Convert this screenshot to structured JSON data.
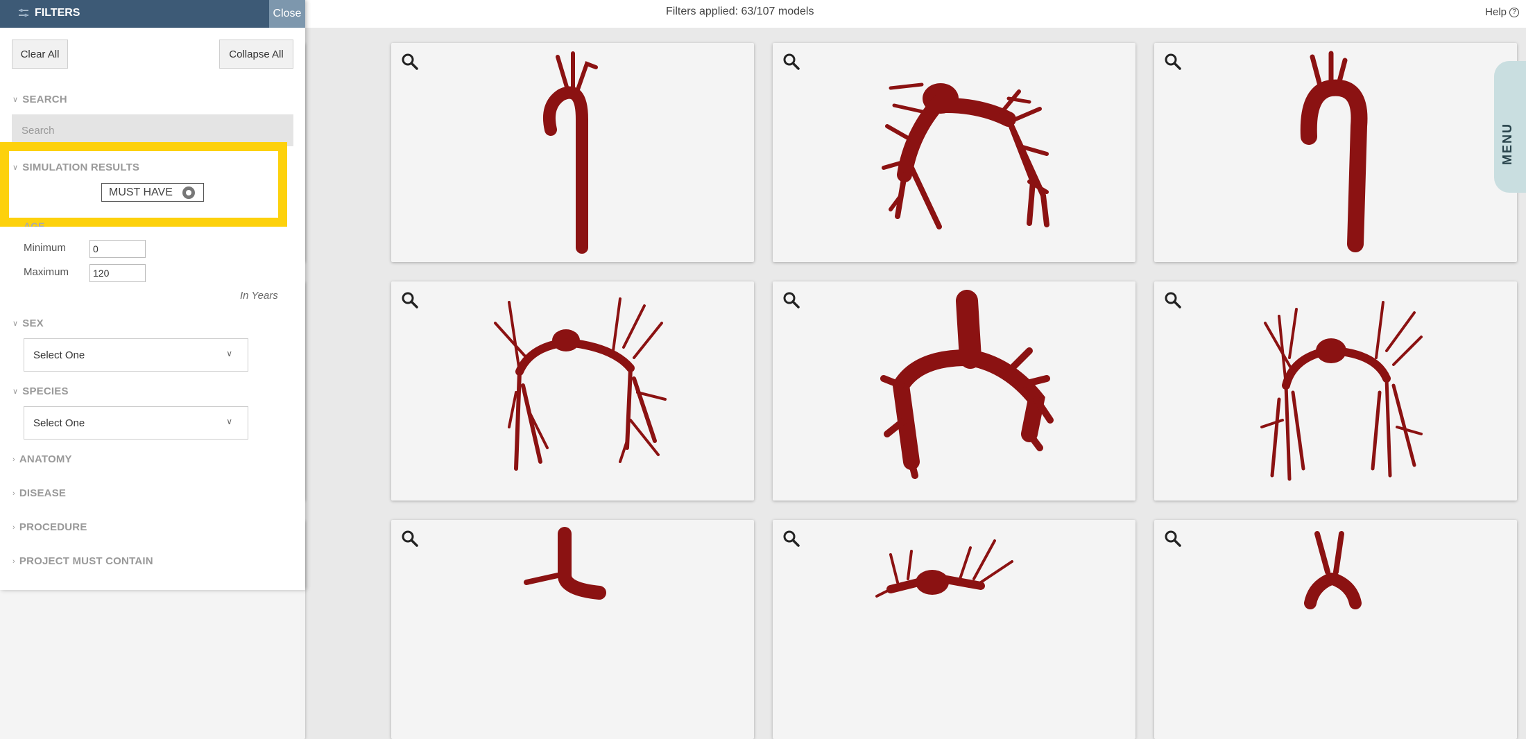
{
  "topbar": {
    "filters_applied": "Filters applied: 63/107 models",
    "help_label": "Help",
    "help_icon": "?"
  },
  "menu_tab": {
    "label": "MENU"
  },
  "panel": {
    "title": "FILTERS",
    "close_label": "Close",
    "clear_all_label": "Clear All",
    "collapse_all_label": "Collapse All",
    "search": {
      "heading": "SEARCH",
      "placeholder": "Search"
    },
    "simulation_results": {
      "heading": "SIMULATION RESULTS",
      "toggle_label": "MUST HAVE"
    },
    "age": {
      "heading": "AGE",
      "minimum_label": "Minimum",
      "minimum_value": "0",
      "maximum_label": "Maximum",
      "maximum_value": "120",
      "unit_note": "In Years"
    },
    "sex": {
      "heading": "SEX",
      "selected": "Select One"
    },
    "species": {
      "heading": "SPECIES",
      "selected": "Select One"
    },
    "collapsed_sections": [
      "ANATOMY",
      "DISEASE",
      "PROCEDURE",
      "PROJECT MUST CONTAIN"
    ]
  },
  "colors": {
    "panel_header": "#3d5a76",
    "close_button": "#7d97ad",
    "highlight": "#fdd10c",
    "model_red": "#8b1212",
    "menu_tab": "#c9dee0"
  },
  "models": [
    {
      "kind": "aorta-thin"
    },
    {
      "kind": "pulmonary-branch"
    },
    {
      "kind": "aorta-thick"
    },
    {
      "kind": "pulmonary-tree"
    },
    {
      "kind": "pulmonary-trunk"
    },
    {
      "kind": "pulmonary-tree-dense"
    },
    {
      "kind": "aorta-partial"
    },
    {
      "kind": "pulmonary-partial"
    },
    {
      "kind": "aorta-branches-partial"
    }
  ]
}
